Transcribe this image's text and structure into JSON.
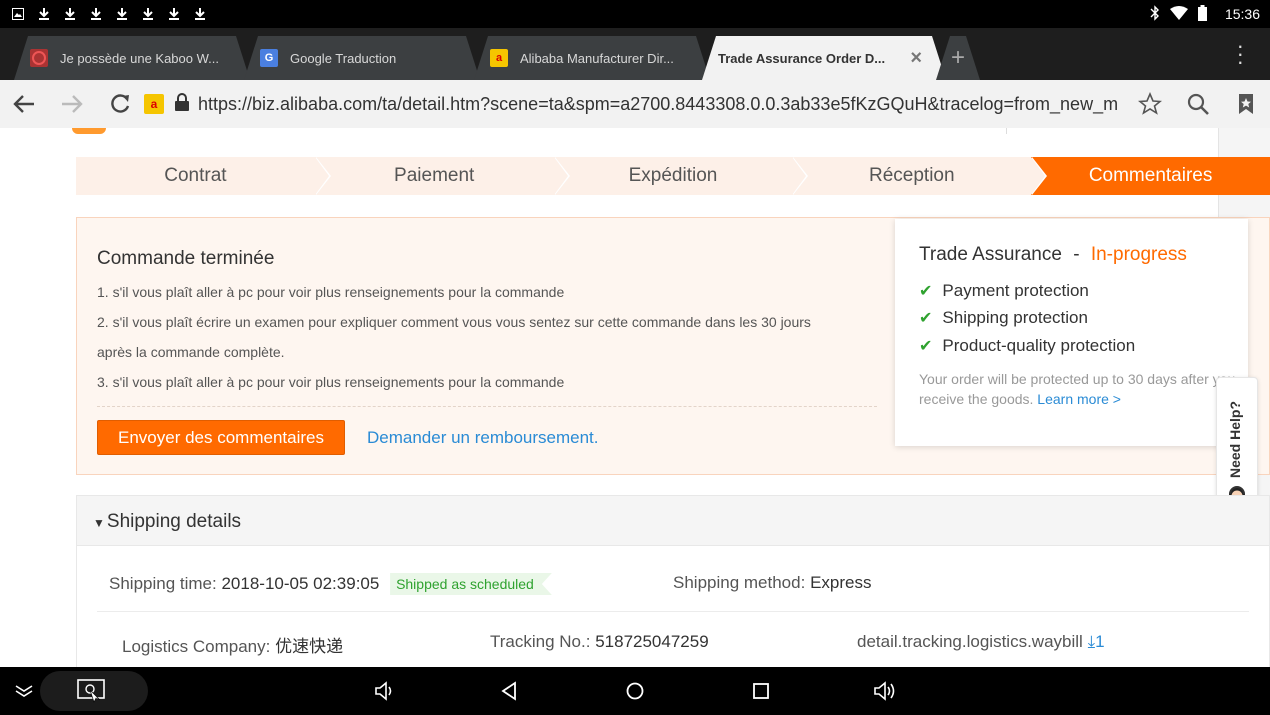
{
  "status_bar": {
    "time": "15:36",
    "left_icons": [
      "image-icon",
      "download-icon",
      "download-icon",
      "download-icon",
      "download-icon",
      "download-icon",
      "download-icon",
      "download-icon"
    ]
  },
  "tabs": [
    {
      "title": "Je possède une Kaboo W...",
      "icon": "circle-favicon"
    },
    {
      "title": "Google Traduction",
      "icon": "google-translate-favicon"
    },
    {
      "title": "Alibaba Manufacturer Dir...",
      "icon": "alibaba-favicon"
    },
    {
      "title": "Trade Assurance Order D...",
      "icon": "none",
      "active": true
    }
  ],
  "address_bar": {
    "url": "https://biz.alibaba.com/ta/detail.htm?scene=ta&spm=a2700.8443308.0.0.3ab33e5fKzGQuH&tracelog=from_new_m"
  },
  "steps": [
    "Contrat",
    "Paiement",
    "Expédition",
    "Réception",
    "Commentaires"
  ],
  "active_step": 4,
  "order": {
    "title": "Commande terminée",
    "lines": [
      "1. s'il vous plaît aller à pc pour voir plus renseignements pour la commande",
      "2. s'il vous plaît écrire un examen pour expliquer comment vous vous sentez sur cette commande dans les 30 jours",
      "après la commande complète.",
      "3. s'il vous plaît aller à pc pour voir plus renseignements pour la commande"
    ],
    "feedback_button": "Envoyer des commentaires",
    "refund_link": "Demander un remboursement."
  },
  "trade_assurance": {
    "title": "Trade Assurance",
    "separator": "-",
    "status": "In-progress",
    "items": [
      "Payment protection",
      "Shipping protection",
      "Product-quality protection"
    ],
    "note": "Your order will be protected up to 30 days after you receive the goods.",
    "learn_more": "Learn more >"
  },
  "need_help": "Need Help?",
  "shipping": {
    "header": "Shipping details",
    "time_label": "Shipping time:",
    "time_value": "2018-10-05 02:39:05",
    "badge": "Shipped as scheduled",
    "method_label": "Shipping method:",
    "method_value": "Express",
    "company_label": "Logistics Company:",
    "company_value": "优速快递",
    "tracking_label": "Tracking No.:",
    "tracking_value": "518725047259",
    "waybill_label": "detail.tracking.logistics.waybill",
    "waybill_count": "1"
  },
  "colors": {
    "accent": "#ff6a00",
    "link": "#2a8bd5",
    "success": "#2fa22f"
  }
}
